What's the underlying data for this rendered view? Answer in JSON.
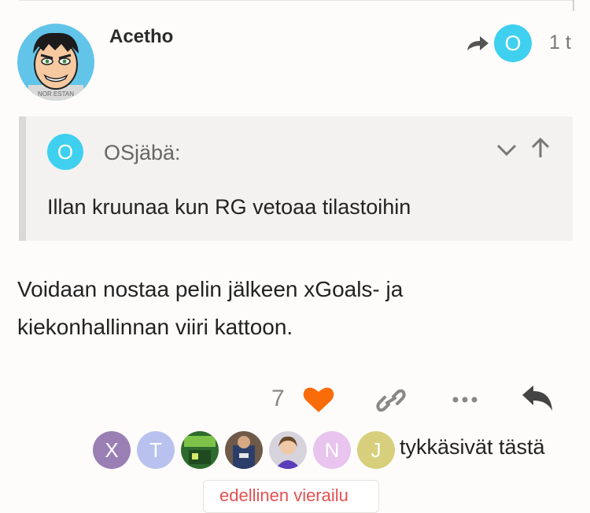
{
  "post": {
    "username": "Acetho",
    "reply_to_avatar_letter": "O",
    "date": "1 t",
    "avatar_caption": "NOR ESTAN"
  },
  "quote": {
    "avatar_letter": "O",
    "username": "OSjäbä:",
    "text": "Illan kruunaa kun RG vetoaa tilastoihin"
  },
  "body": {
    "text": "Voidaan nostaa pelin jälkeen xGoals- ja kiekonhallinnan viiri kattoon."
  },
  "actions": {
    "like_count": "7",
    "icons": [
      "heart-icon",
      "link-icon",
      "more-icon",
      "reply-icon"
    ]
  },
  "likers": {
    "letters": [
      "X",
      "T",
      "N",
      "J"
    ],
    "label": "tykkäsivät tästä",
    "colors": [
      "#9a7fb5",
      "#b9c2ee",
      "#e8c4ee",
      "#d7cf7c"
    ]
  },
  "footer": {
    "badge_text": "edellinen vierailu"
  },
  "colors": {
    "accent_circle": "#3fd0ef",
    "heart": "#fa6c0a",
    "background": "#fdfcfb"
  }
}
